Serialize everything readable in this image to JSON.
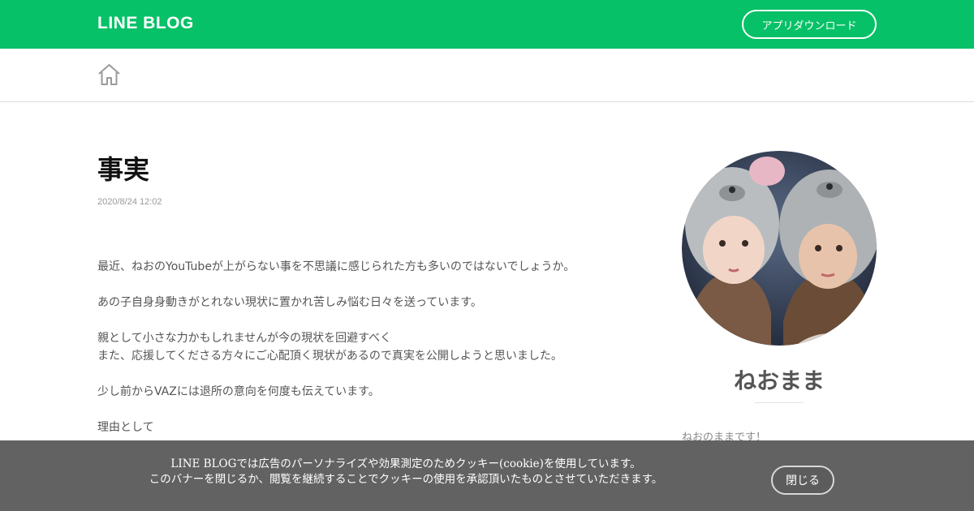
{
  "header": {
    "logo": "LINE BLOG",
    "app_download_label": "アプリダウンロード",
    "brand_color": "#06c167"
  },
  "nav": {
    "home_icon": "home-icon"
  },
  "article": {
    "title": "事実",
    "date": "2020/8/24 12:02",
    "paragraphs": [
      [
        "最近、ねおのYouTubeが上がらない事を不思議に感じられた方も多いのではないでしょうか。"
      ],
      [
        "あの子自身身動きがとれない現状に置かれ苦しみ悩む日々を送っています。"
      ],
      [
        "親として小さな力かもしれませんが今の現状を回避すべく",
        "また、応援してくださる方々にご心配頂く現状があるので真実を公開しようと思いました。"
      ],
      [
        "少し前からVAZには退所の意向を何度も伝えています。"
      ],
      [
        "理由として"
      ]
    ]
  },
  "sidebar": {
    "author_name": "ねおまま",
    "bio": "ねおのままです！"
  },
  "cookie_banner": {
    "line1": "LINE BLOGでは広告のパーソナライズや効果測定のためクッキー(cookie)を使用しています。",
    "line2": "このバナーを閉じるか、閲覧を継続することでクッキーの使用を承認頂いたものとさせていただきます。",
    "close_label": "閉じる"
  }
}
